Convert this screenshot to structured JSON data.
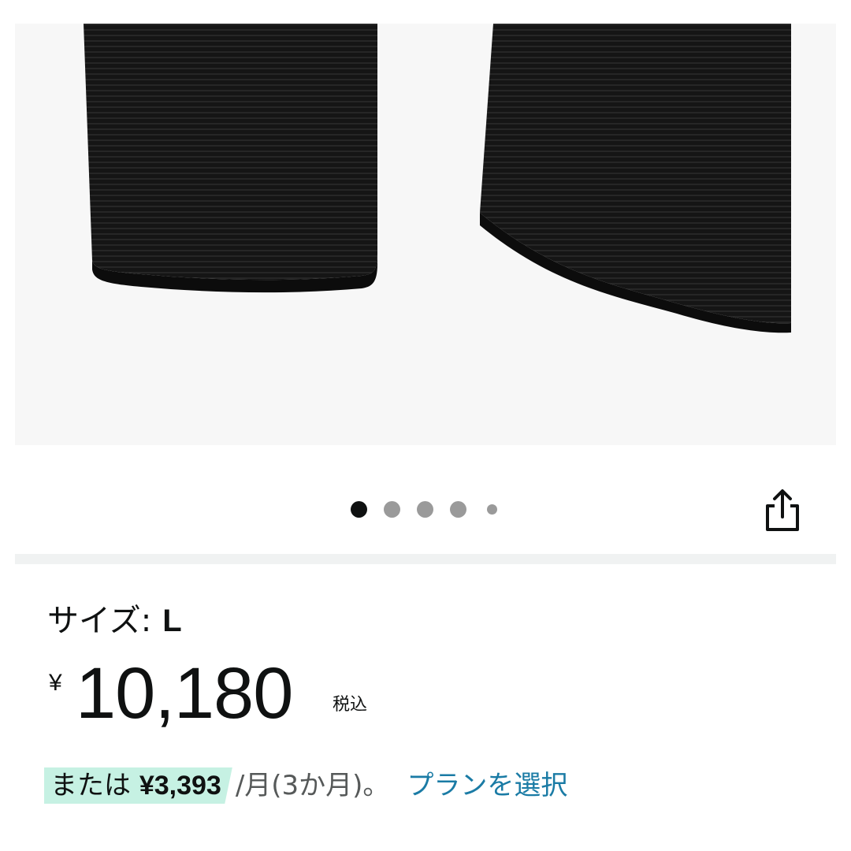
{
  "gallery": {
    "image_description_icon": "product-photo-knee-sleeves",
    "dots": [
      {
        "active": true
      },
      {
        "active": false
      },
      {
        "active": false
      },
      {
        "active": false
      },
      {
        "active": false,
        "small": true
      }
    ],
    "share_icon": "share-icon"
  },
  "product": {
    "size_label": "サイズ:",
    "size_value": "L",
    "price_symbol": "¥",
    "price_whole": "10,180",
    "tax_label": "税込"
  },
  "installment": {
    "prefix": "または",
    "amount": "¥3,393",
    "per": "/月(3か月)。",
    "plan_link": "プランを選択"
  },
  "colors": {
    "accent_link": "#1a7ba5",
    "installment_highlight": "#c6f1e3",
    "image_bg": "#f7f7f7"
  }
}
